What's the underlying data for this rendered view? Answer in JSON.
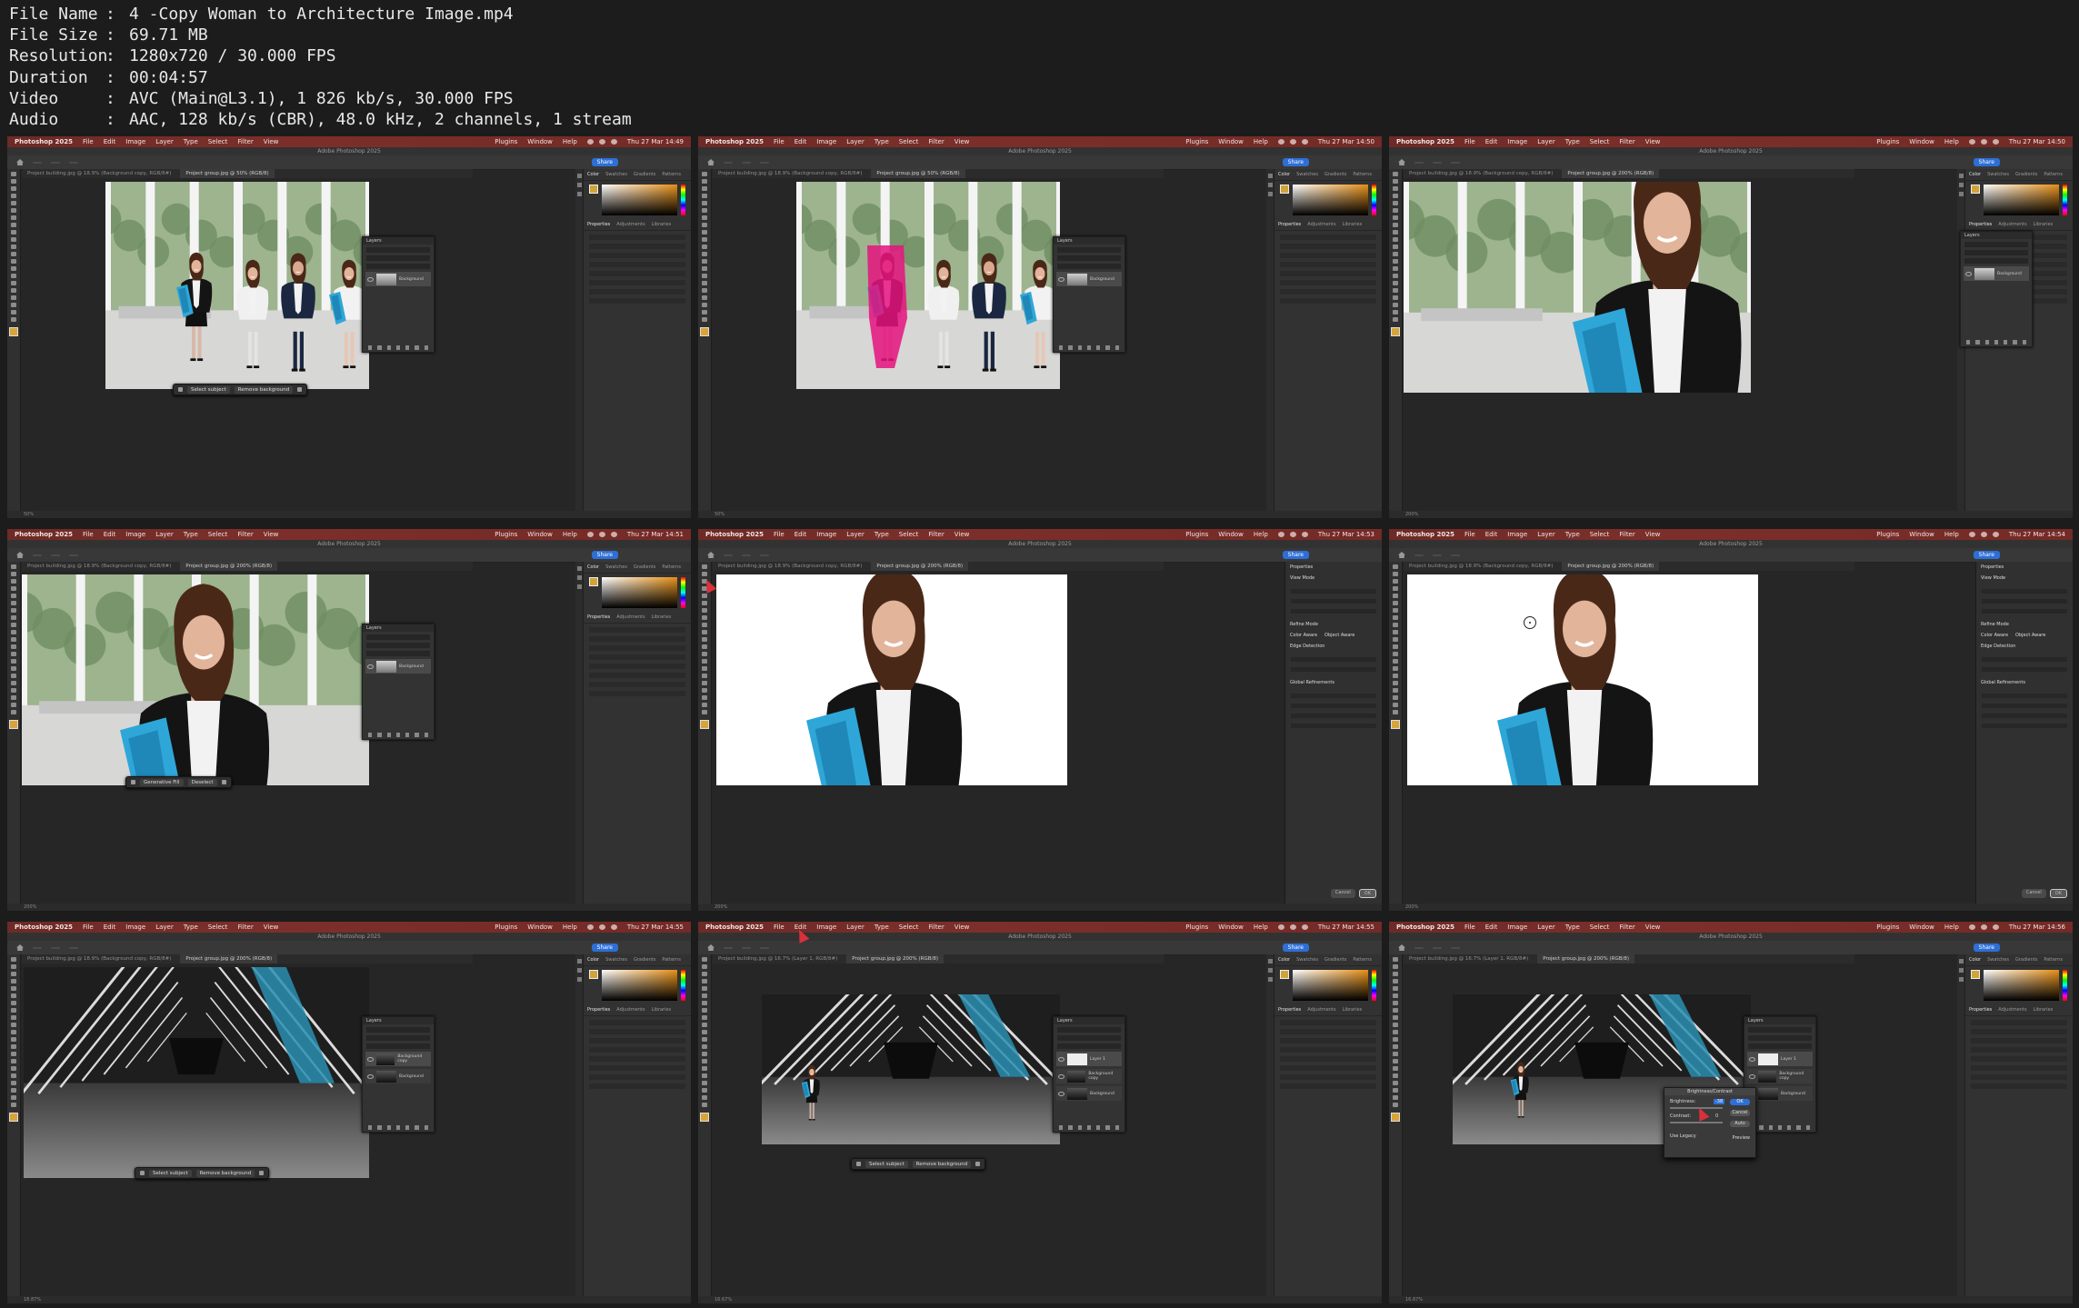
{
  "info": [
    {
      "key": "File Name",
      "value": "4 -Copy Woman to Architecture Image.mp4"
    },
    {
      "key": "File Size",
      "value": "69.71 MB"
    },
    {
      "key": "Resolution",
      "value": "1280x720 / 30.000 FPS"
    },
    {
      "key": "Duration",
      "value": "00:04:57"
    },
    {
      "key": "Video",
      "value": "AVC (Main@L3.1), 1 826 kb/s, 30.000 FPS"
    },
    {
      "key": "Audio",
      "value": "AAC, 128 kb/s (CBR), 48.0 kHz, 2 channels, 1 stream"
    }
  ],
  "app": {
    "name": "Photoshop 2025",
    "menu": [
      "File",
      "Edit",
      "Image",
      "Layer",
      "Type",
      "Select",
      "Filter",
      "View"
    ],
    "menu_right": [
      "Plugins",
      "Window",
      "Help"
    ],
    "window_title": "Adobe Photoshop 2025",
    "share": "Share"
  },
  "panel_tabs": [
    "Color",
    "Swatches",
    "Gradients",
    "Patterns"
  ],
  "props_tabs": [
    "Properties",
    "Adjustments",
    "Libraries"
  ],
  "colors": {
    "menubar": "#7c2f2a",
    "accent": "#2d6fd6"
  },
  "frames": [
    {
      "time": "Thu 27 Mar 14:49",
      "tab1": "Project building.jpg @ 18.9% (Background copy, RGB/8#)",
      "tab2": "Project group.jpg @ 50% (RGB/8)",
      "zoom": "50%",
      "ctx": [
        "Select subject",
        "Remove background"
      ]
    },
    {
      "time": "Thu 27 Mar 14:50",
      "tab1": "Project building.jpg @ 18.9% (Background copy, RGB/8#)",
      "tab2": "Project group.jpg @ 50% (RGB/8)",
      "zoom": "50%"
    },
    {
      "time": "Thu 27 Mar 14:50",
      "tab1": "Project building.jpg @ 18.9% (Background copy, RGB/8#)",
      "tab2": "Project group.jpg @ 200% (RGB/8)",
      "zoom": "200%"
    },
    {
      "time": "Thu 27 Mar 14:51",
      "tab1": "Project building.jpg @ 18.9% (Background copy, RGB/8#)",
      "tab2": "Project group.jpg @ 200% (RGB/8)",
      "zoom": "200%",
      "ctx": [
        "Generative Fill",
        "Deselect"
      ]
    },
    {
      "time": "Thu 27 Mar 14:53",
      "tab1": "Project building.jpg @ 18.9% (Background copy, RGB/8#)",
      "tab2": "Project group.jpg @ 200% (RGB/8)",
      "zoom": "200%"
    },
    {
      "time": "Thu 27 Mar 14:54",
      "tab1": "Project building.jpg @ 18.9% (Background copy, RGB/8#)",
      "tab2": "Project group.jpg @ 200% (RGB/8)",
      "zoom": "200%"
    },
    {
      "time": "Thu 27 Mar 14:55",
      "tab1": "Project building.jpg @ 18.9% (Background copy, RGB/8#)",
      "tab2": "Project group.jpg @ 200% (RGB/8)",
      "zoom": "18.87%",
      "ctx": [
        "Select subject",
        "Remove background"
      ]
    },
    {
      "time": "Thu 27 Mar 14:55",
      "tab1": "Project building.jpg @ 16.7% (Layer 1, RGB/8#)",
      "tab2": "Project group.jpg @ 200% (RGB/8)",
      "zoom": "16.67%",
      "ctx": [
        "Select subject",
        "Remove background"
      ]
    },
    {
      "time": "Thu 27 Mar 14:56",
      "tab1": "Project building.jpg @ 16.7% (Layer 1, RGB/8#)",
      "tab2": "Project group.jpg @ 200% (RGB/8)",
      "zoom": "16.67%"
    }
  ],
  "layers": {
    "title": "Layers",
    "background": "Background",
    "background_copy": "Background copy",
    "layer1": "Layer 1"
  },
  "select_mask": {
    "title": "Properties",
    "view_mode": "View Mode",
    "refine_mode": "Refine Mode",
    "color_aware": "Color Aware",
    "object_aware": "Object Aware",
    "edge_detection": "Edge Detection",
    "global_refinements": "Global Refinements",
    "cancel": "Cancel",
    "ok": "OK"
  },
  "brightness_dialog": {
    "title": "Brightness/Contrast",
    "brightness": "Brightness:",
    "contrast": "Contrast:",
    "brightness_value": "-38",
    "contrast_value": "0",
    "ok": "OK",
    "cancel": "Cancel",
    "auto": "Auto",
    "use_legacy": "Use Legacy",
    "preview": "Preview"
  }
}
